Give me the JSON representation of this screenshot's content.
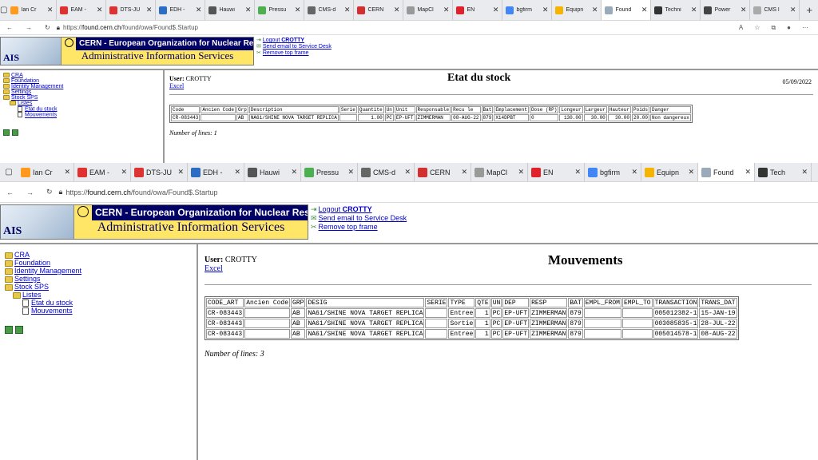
{
  "shot1": {
    "tabs": [
      "Ian Cr",
      "EAM -",
      "DTS-JU",
      "EDH -",
      "Hauwi",
      "Pressu",
      "CMS-d",
      "CERN",
      "MapCl",
      "EN",
      "bgfirm",
      "Equipn",
      "Found",
      "Techni",
      "Power",
      "CMS l"
    ],
    "active_tab_index": 12,
    "url_prefix": "https://",
    "url_host": "found.cern.ch",
    "url_path": "/found/owa/Found$.Startup",
    "header": {
      "cern_title": "CERN - European Organization for Nuclear Research",
      "ais_subtitle": "Administrative Information Services",
      "ais_logo": "AIS",
      "logout_label": "Logout",
      "logout_user": "CROTTY",
      "send_email": "Send email to Service Desk",
      "remove_frame": "Remove top frame"
    },
    "sidebar": {
      "items": [
        "CRA",
        "Foundation",
        "Identity Management",
        "Settings",
        "Stock SPS"
      ],
      "listes": "Listes",
      "sub": [
        "Etat du stock",
        "Mouvements"
      ]
    },
    "page": {
      "user_label": "User:",
      "user": "CROTTY",
      "excel": "Excel",
      "title": "Etat du stock",
      "date": "05/09/2022",
      "columns": [
        "Code",
        "Ancien Code",
        "Grp",
        "Description",
        "Serie",
        "Quantite",
        "Un",
        "Unit",
        "Responsable",
        "Recu le",
        "Bat",
        "Emplacement",
        "Dose (RP)",
        "Longeur",
        "Largeur",
        "Hauteur",
        "Poids",
        "Danger"
      ],
      "rows": [
        [
          "CR-083443",
          "",
          "AB",
          "NA61/SHINE NOVA TARGET REPLICA",
          "",
          "1.00",
          "PC",
          "EP-UFT",
          "ZIMMERMAN",
          "08-AUG-22",
          "879",
          "X14DPBT",
          "0",
          "130.00",
          "30.00",
          "30.00",
          "20.00",
          "Non dangereux"
        ]
      ],
      "nlines": "Number of lines: 1"
    }
  },
  "shot2": {
    "tabs": [
      "Ian Cr",
      "EAM -",
      "DTS-JU",
      "EDH -",
      "Hauwi",
      "Pressu",
      "CMS-d",
      "CERN",
      "MapCl",
      "EN",
      "bgfirm",
      "Equipn",
      "Found",
      "Tech"
    ],
    "active_tab_index": 12,
    "url_prefix": "https://",
    "url_host": "found.cern.ch",
    "url_path": "/found/owa/Found$.Startup",
    "header": {
      "cern_title": "CERN - European Organization for Nuclear Research",
      "ais_subtitle": "Administrative Information Services",
      "ais_logo": "AIS",
      "logout_label": "Logout",
      "logout_user": "CROTTY",
      "send_email": "Send email to Service Desk",
      "remove_frame": "Remove top frame"
    },
    "sidebar": {
      "items": [
        "CRA",
        "Foundation",
        "Identity Management",
        "Settings",
        "Stock SPS"
      ],
      "listes": "Listes",
      "sub": [
        "Etat du stock",
        "Mouvements"
      ]
    },
    "page": {
      "user_label": "User:",
      "user": "CROTTY",
      "excel": "Excel",
      "title": "Mouvements",
      "columns": [
        "CODE_ART",
        "Ancien Code",
        "GRP",
        "DESIG",
        "SERIE",
        "TYPE",
        "QTE",
        "UN",
        "DEP",
        "RESP",
        "BAT",
        "EMPL_FROM",
        "EMPL_TO",
        "TRANSACTION",
        "TRANS_DAT"
      ],
      "rows": [
        [
          "CR-083443",
          "",
          "AB",
          "NA61/SHINE NOVA TARGET REPLICA",
          "",
          "Entree",
          "1",
          "PC",
          "EP-UFT",
          "ZIMMERMAN",
          "879",
          "",
          "",
          "005012382-1",
          "15-JAN-19"
        ],
        [
          "CR-083443",
          "",
          "AB",
          "NA61/SHINE NOVA TARGET REPLICA",
          "",
          "Sortie",
          "1",
          "PC",
          "EP-UFT",
          "ZIMMERMAN",
          "879",
          "",
          "",
          "003085835-1",
          "28-JUL-22"
        ],
        [
          "CR-083443",
          "",
          "AB",
          "NA61/SHINE NOVA TARGET REPLICA",
          "",
          "Entree",
          "1",
          "PC",
          "EP-UFT",
          "ZIMMERMAN",
          "879",
          "",
          "",
          "005014578-1",
          "08-AUG-22"
        ]
      ],
      "nlines": "Number of lines: 3"
    }
  },
  "colors": {
    "banner_yellow": "#ffe666",
    "cern_blue": "#000066",
    "link_blue": "#0000cc",
    "folder": "#e8c84a"
  },
  "icons": [
    "tab-actions-icon",
    "back-icon",
    "forward-icon",
    "refresh-icon",
    "lock-icon",
    "read-aloud-icon",
    "favorite-icon",
    "collections-icon",
    "profile-icon",
    "menu-icon",
    "minimize-icon",
    "maximize-icon",
    "close-icon"
  ]
}
